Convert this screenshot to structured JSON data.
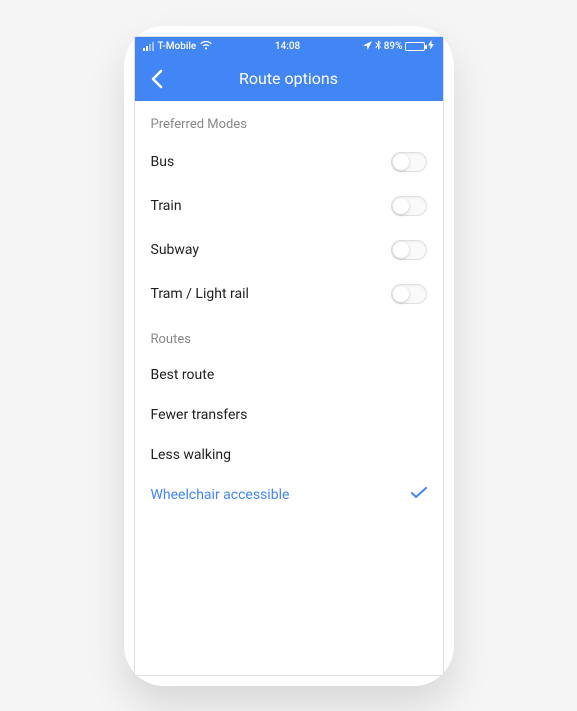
{
  "status": {
    "carrier": "T-Mobile",
    "time": "14:08",
    "battery_pct": "89%"
  },
  "nav": {
    "title": "Route options"
  },
  "sections": {
    "modes_header": "Preferred Modes",
    "routes_header": "Routes"
  },
  "modes": [
    {
      "label": "Bus",
      "on": false
    },
    {
      "label": "Train",
      "on": false
    },
    {
      "label": "Subway",
      "on": false
    },
    {
      "label": "Tram / Light rail",
      "on": false
    }
  ],
  "routes": [
    {
      "label": "Best route",
      "selected": false
    },
    {
      "label": "Fewer transfers",
      "selected": false
    },
    {
      "label": "Less walking",
      "selected": false
    },
    {
      "label": "Wheelchair accessible",
      "selected": true
    }
  ]
}
